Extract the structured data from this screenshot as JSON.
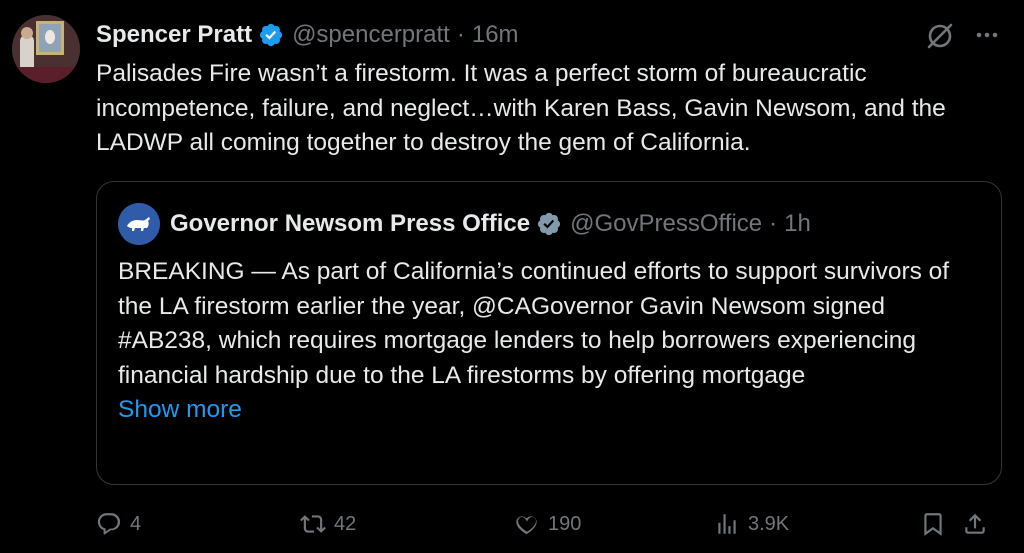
{
  "tweet": {
    "author_name": "Spencer Pratt",
    "handle": "@spencerpratt",
    "separator": "·",
    "time": "16m",
    "text": "Palisades Fire wasn’t a firestorm. It was a perfect storm of bureaucratic incompetence, failure, and neglect…with Karen Bass, Gavin Newsom, and the LADWP all coming together to destroy the gem of California.",
    "verified_color": "#1d9bf0"
  },
  "quote": {
    "author_name": "Governor Newsom Press Office",
    "handle": "@GovPressOffice",
    "separator": "·",
    "time": "1h",
    "text": "BREAKING — As part of California’s continued efforts to support survivors of the LA firestorm earlier the year, @CAGovernor Gavin Newsom signed #AB238, which requires mortgage lenders to help borrowers experiencing financial hardship due to the LA firestorms by offering mortgage",
    "show_more": "Show more",
    "verified_color": "#829aab"
  },
  "actions": {
    "replies": "4",
    "reposts": "42",
    "likes": "190",
    "views": "3.9K"
  },
  "icons": [
    "verified-badge-icon",
    "grok-icon",
    "more-icon",
    "reply-icon",
    "repost-icon",
    "like-icon",
    "views-icon",
    "bookmark-icon",
    "share-icon"
  ],
  "colors": {
    "background": "#000000",
    "text": "#e7e9ea",
    "muted": "#71767b",
    "link": "#1d9bf0",
    "border": "#333639"
  }
}
